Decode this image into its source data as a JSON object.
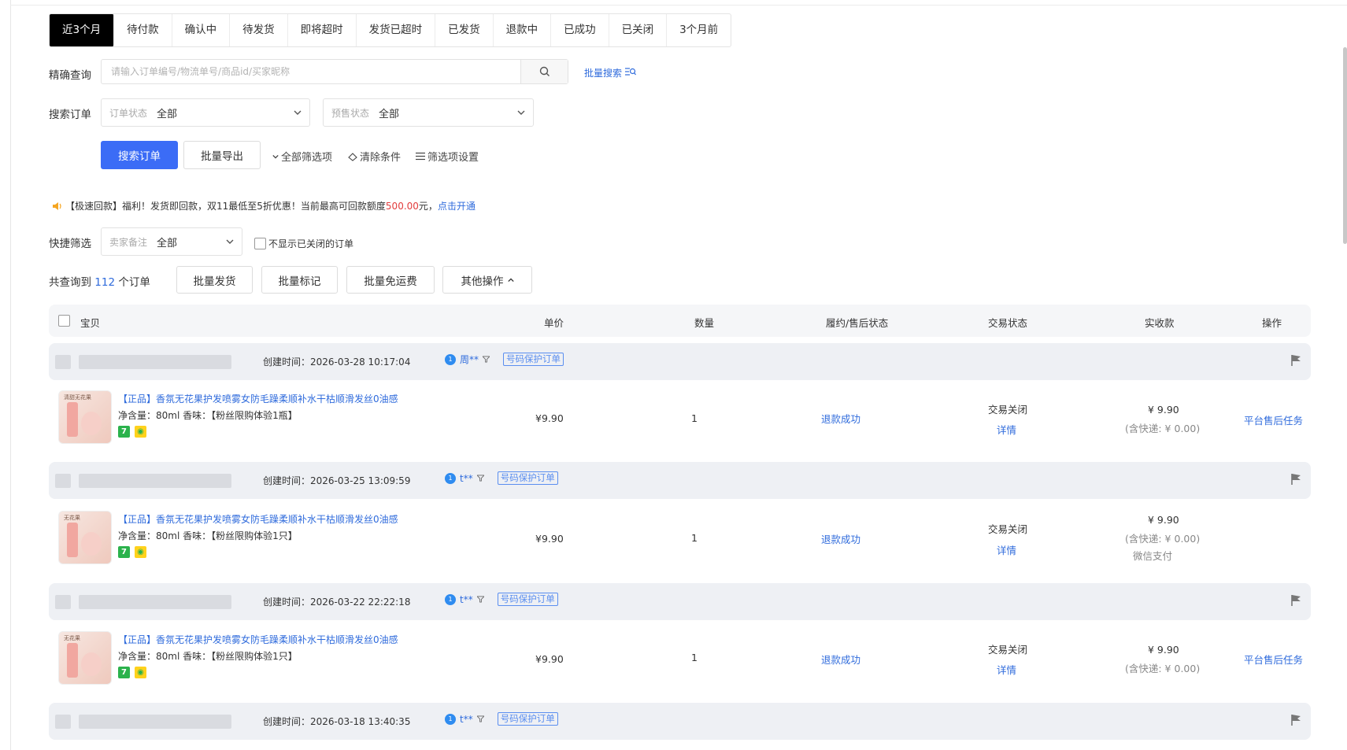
{
  "tabs": [
    "近3个月",
    "待付款",
    "确认中",
    "待发货",
    "即将超时",
    "发货已超时",
    "已发货",
    "退款中",
    "已成功",
    "已关闭",
    "3个月前"
  ],
  "search": {
    "label": "精确查询",
    "placeholder": "请输入订单编号/物流单号/商品id/买家昵称",
    "batch_link": "批量搜索"
  },
  "filters": {
    "label": "搜索订单",
    "order_status_label": "订单状态",
    "order_status_value": "全部",
    "presale_label": "预售状态",
    "presale_value": "全部"
  },
  "actions": {
    "search_btn": "搜索订单",
    "export_btn": "批量导出",
    "all_filters": "全部筛选项",
    "clear": "清除条件",
    "filter_settings": "筛选项设置"
  },
  "notice": {
    "prefix": "【极速回款】福利！发货即回款，双11最低至5折优惠！当前最高可回款额度",
    "amount": "500.00",
    "suffix": "元，",
    "link": "点击开通"
  },
  "quick": {
    "label": "快捷筛选",
    "remark_label": "卖家备注",
    "remark_value": "全部",
    "hide_closed": "不显示已关闭的订单"
  },
  "summary": {
    "prefix": "共查询到",
    "count": "112",
    "suffix": "个订单",
    "batch_ship": "批量发货",
    "batch_mark": "批量标记",
    "batch_free": "批量免运费",
    "other_ops": "其他操作"
  },
  "table_headers": {
    "item": "宝贝",
    "price": "单价",
    "qty": "数量",
    "aftersale": "履约/售后状态",
    "trade": "交易状态",
    "paid": "实收款",
    "ops": "操作"
  },
  "orders": [
    {
      "create_time": "创建时间：2026-03-28 10:17:04",
      "buyer": "周**",
      "protect": "号码保护订单",
      "title": "【正品】香氛无花果护发喷雾女防毛躁柔顺补水干枯顺滑发丝0油感",
      "spec": "净含量：80ml  香味：【粉丝限购体验1瓶】",
      "thumb_text": "清甜无花果",
      "price": "¥9.90",
      "qty": "1",
      "aftersale": "退款成功",
      "trade": "交易关闭",
      "detail": "详情",
      "paid": "¥ 9.90",
      "shipping": "(含快递: ¥ 0.00)",
      "pay_method": "",
      "op": "平台售后任务"
    },
    {
      "create_time": "创建时间：2026-03-25 13:09:59",
      "buyer": "t**",
      "protect": "号码保护订单",
      "title": "【正品】香氛无花果护发喷雾女防毛躁柔顺补水干枯顺滑发丝0油感",
      "spec": "净含量：80ml  香味：【粉丝限购体验1只】",
      "thumb_text": "无花果",
      "price": "¥9.90",
      "qty": "1",
      "aftersale": "退款成功",
      "trade": "交易关闭",
      "detail": "详情",
      "paid": "¥ 9.90",
      "shipping": "(含快递: ¥ 0.00)",
      "pay_method": "微信支付",
      "op": ""
    },
    {
      "create_time": "创建时间：2026-03-22 22:22:18",
      "buyer": "t**",
      "protect": "号码保护订单",
      "title": "【正品】香氛无花果护发喷雾女防毛躁柔顺补水干枯顺滑发丝0油感",
      "spec": "净含量：80ml  香味：【粉丝限购体验1只】",
      "thumb_text": "无花果",
      "price": "¥9.90",
      "qty": "1",
      "aftersale": "退款成功",
      "trade": "交易关闭",
      "detail": "详情",
      "paid": "¥ 9.90",
      "shipping": "(含快递: ¥ 0.00)",
      "pay_method": "",
      "op": "平台售后任务"
    },
    {
      "create_time": "创建时间：2026-03-18 13:40:35",
      "buyer": "t**",
      "protect": "号码保护订单"
    }
  ]
}
